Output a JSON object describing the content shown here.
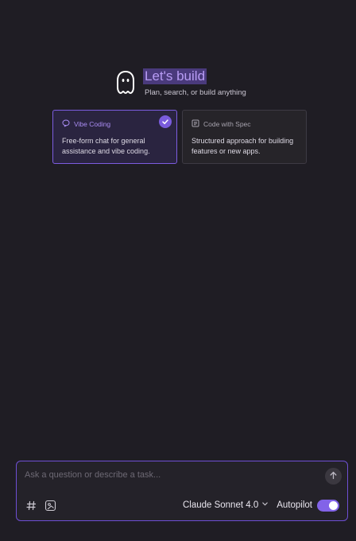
{
  "hero": {
    "title": "Let's build",
    "subtitle": "Plan, search, or build anything",
    "logo_icon": "ghost-logo-icon"
  },
  "modes": [
    {
      "title": "Vibe Coding",
      "description": "Free-form chat for general assistance and vibe coding.",
      "icon": "chat-bubble-icon",
      "selected": true
    },
    {
      "title": "Code with Spec",
      "description": "Structured approach for building features or new apps.",
      "icon": "spec-document-icon",
      "selected": false
    }
  ],
  "composer": {
    "placeholder": "Ask a question or describe a task...",
    "send_icon": "arrow-up-icon",
    "context_icon": "hash-icon",
    "image_icon": "image-upload-icon",
    "model": "Claude Sonnet 4.0",
    "model_icon": "chevron-down-icon",
    "autopilot_label": "Autopilot",
    "autopilot_on": true
  },
  "colors": {
    "background": "#1f1d24",
    "accent": "#7c5ce0",
    "title_highlight": "#4a3a7c"
  }
}
